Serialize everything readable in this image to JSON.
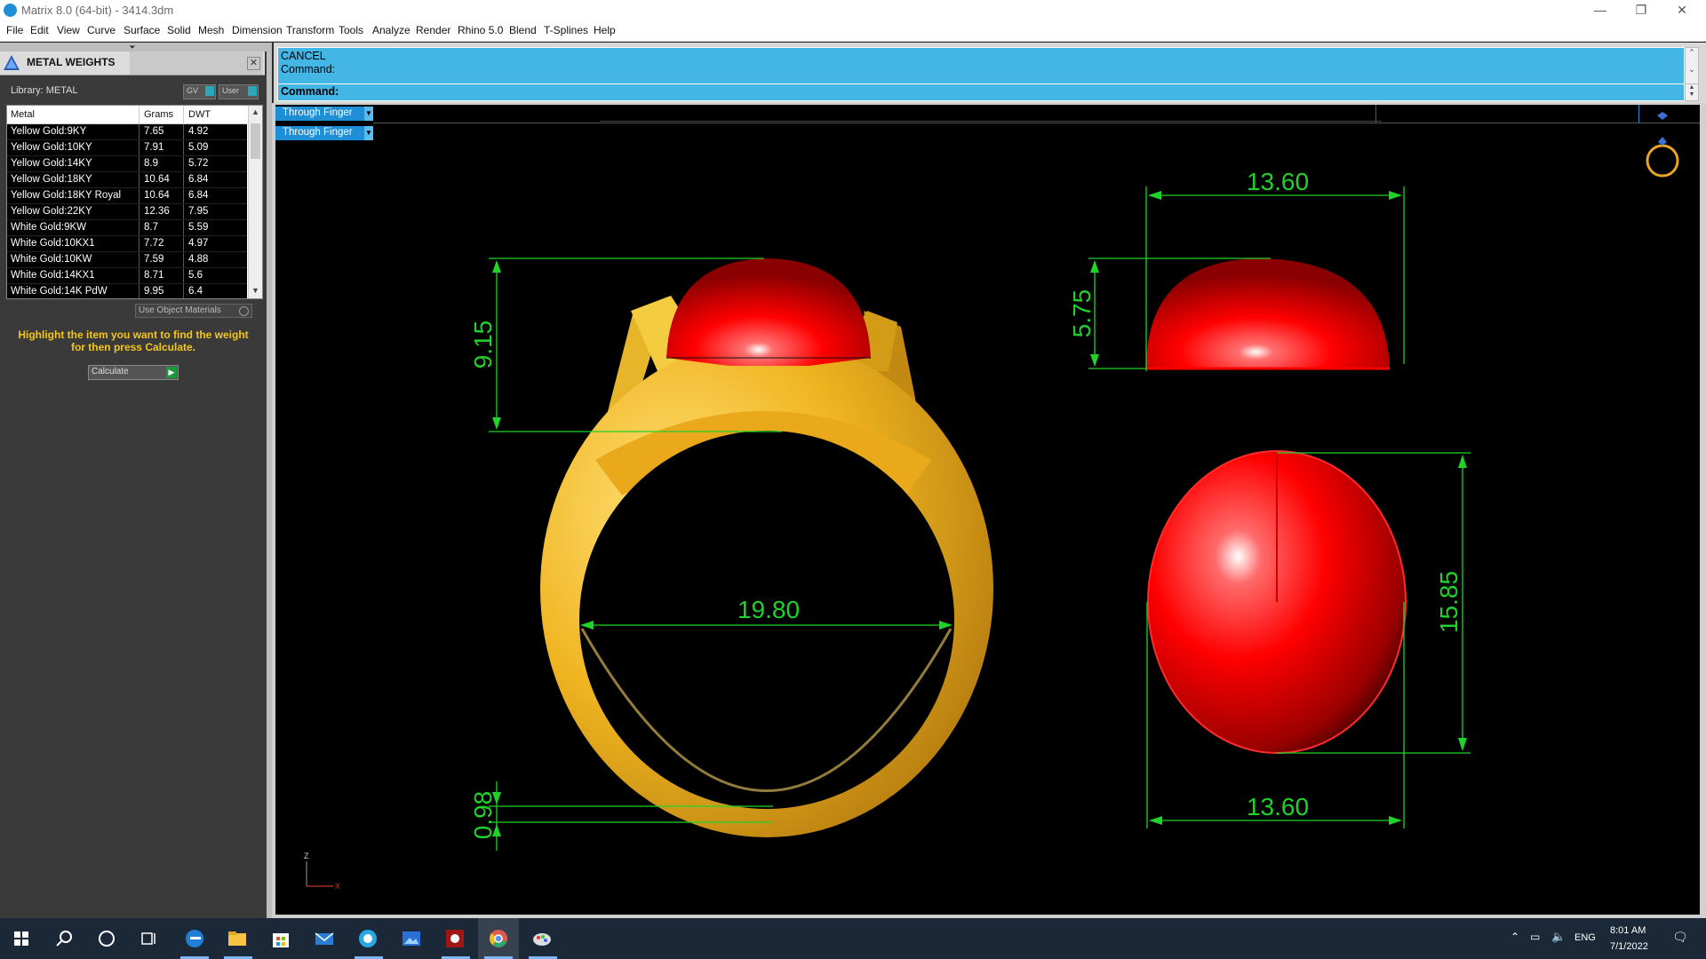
{
  "window": {
    "title": "Matrix 8.0 (64-bit) - 3414.3dm",
    "minimize_glyph": "—",
    "restore_glyph": "❐",
    "close_glyph": "✕"
  },
  "menu": [
    "File",
    "Edit",
    "View",
    "Curve",
    "Surface",
    "Solid",
    "Mesh",
    "Dimension",
    "Transform",
    "Tools",
    "Analyze",
    "Render",
    "Rhino 5.0",
    "Blend",
    "T-Splines",
    "Help"
  ],
  "panel": {
    "title": "METAL WEIGHTS",
    "library_label": "Library: METAL",
    "toggle_gv": "GV",
    "toggle_user": "User",
    "columns": [
      "Metal",
      "Grams",
      "DWT"
    ],
    "rows": [
      {
        "metal": "Yellow Gold:9KY",
        "grams": "7.65",
        "dwt": "4.92"
      },
      {
        "metal": "Yellow Gold:10KY",
        "grams": "7.91",
        "dwt": "5.09"
      },
      {
        "metal": "Yellow Gold:14KY",
        "grams": "8.9",
        "dwt": "5.72"
      },
      {
        "metal": "Yellow Gold:18KY",
        "grams": "10.64",
        "dwt": "6.84"
      },
      {
        "metal": "Yellow Gold:18KY Royal",
        "grams": "10.64",
        "dwt": "6.84"
      },
      {
        "metal": "Yellow Gold:22KY",
        "grams": "12.36",
        "dwt": "7.95"
      },
      {
        "metal": "White Gold:9KW",
        "grams": "8.7",
        "dwt": "5.59"
      },
      {
        "metal": "White Gold:10KX1",
        "grams": "7.72",
        "dwt": "4.97"
      },
      {
        "metal": "White Gold:10KW",
        "grams": "7.59",
        "dwt": "4.88"
      },
      {
        "metal": "White Gold:14KX1",
        "grams": "8.71",
        "dwt": "5.6"
      },
      {
        "metal": "White Gold:14K PdW",
        "grams": "9.95",
        "dwt": "6.4"
      }
    ],
    "use_object_materials": "Use Object Materials",
    "hint_line1": "Highlight the item you want to find the weight",
    "hint_line2": "for then press Calculate.",
    "calculate_label": "Calculate"
  },
  "command": {
    "line1": "CANCEL",
    "line2": "Command:",
    "prompt": "Command:"
  },
  "viewport": {
    "tab1": "Through Finger",
    "tab2": "Through Finger",
    "axis_label": "Z",
    "axis_x_label": "X"
  },
  "dimensions": {
    "ring_height": "9.15",
    "ring_inner_diameter": "19.80",
    "ring_thickness": "0.98",
    "stone_top_width": "13.60",
    "stone_height": "5.75",
    "stone_length": "15.85",
    "stone_bottom_width": "13.60"
  },
  "colors": {
    "dimension_green": "#1fd32a",
    "gold": "#e8a81c",
    "stone_red": "#ff0000",
    "command_blue": "#43b6e6",
    "taskbar": "#1b2838"
  },
  "taskbar": {
    "language": "ENG",
    "time": "8:01 AM",
    "date": "7/1/2022"
  }
}
